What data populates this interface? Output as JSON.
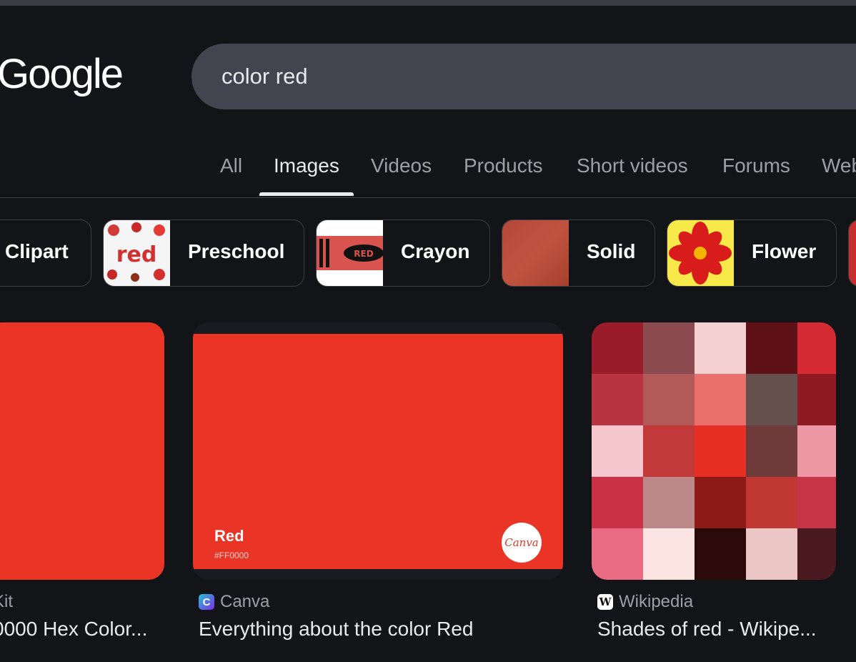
{
  "logo": "Google",
  "search": {
    "query": "color red"
  },
  "tabs": [
    "All",
    "Images",
    "Videos",
    "Products",
    "Short videos",
    "Forums",
    "Web"
  ],
  "active_tab": "Images",
  "chips": [
    {
      "label": "Clipart"
    },
    {
      "label": "Preschool",
      "thumb_text": "red"
    },
    {
      "label": "Crayon",
      "thumb_text": "RED"
    },
    {
      "label": "Solid"
    },
    {
      "label": "Flower"
    }
  ],
  "results": [
    {
      "source": "Kit",
      "title": "0000 Hex Color..."
    },
    {
      "source": "Canva",
      "title": "Everything about the color Red",
      "swatch_name": "Red",
      "swatch_hex": "#FF0000",
      "badge": "Canva"
    },
    {
      "source": "Wikipedia",
      "title": "Shades of red - Wikipe..."
    }
  ],
  "colors": {
    "accent_red": "#e93426",
    "background": "#131418",
    "searchbar": "#43444f"
  }
}
